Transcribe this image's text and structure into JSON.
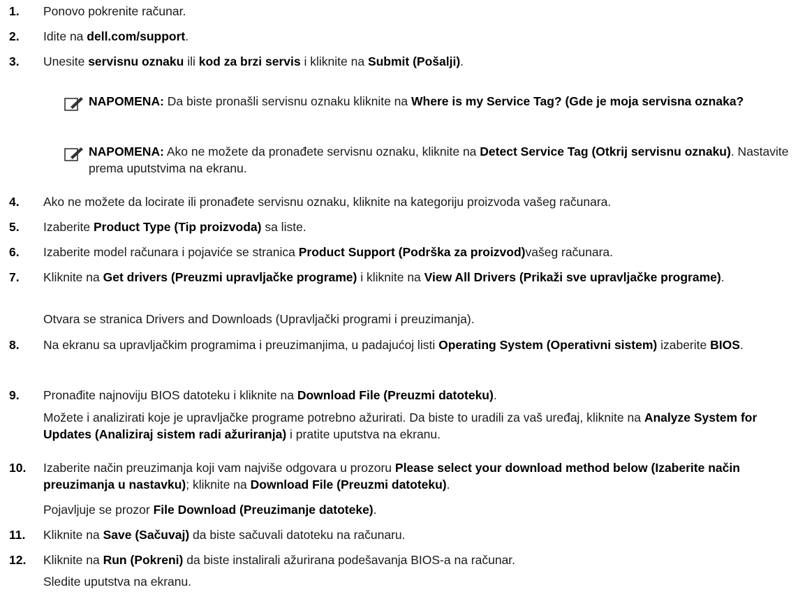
{
  "steps": [
    {
      "n": "1.",
      "parts": [
        {
          "t": "Ponovo pokrenite računar."
        }
      ]
    },
    {
      "n": "2.",
      "parts": [
        {
          "t": "Idite na "
        },
        {
          "t": "dell.com/support",
          "b": true
        },
        {
          "t": "."
        }
      ]
    },
    {
      "n": "3.",
      "parts": [
        {
          "t": "Unesite "
        },
        {
          "t": "servisnu oznaku",
          "b": true
        },
        {
          "t": " ili "
        },
        {
          "t": "kod za brzi servis",
          "b": true
        },
        {
          "t": " i kliknite na "
        },
        {
          "t": "Submit (Pošalji)",
          "b": true
        },
        {
          "t": "."
        }
      ]
    },
    {
      "n": "4.",
      "parts": [
        {
          "t": "Ako ne možete da locirate ili pronađete servisnu oznaku, kliknite na kategoriju proizvoda vašeg računara."
        }
      ]
    },
    {
      "n": "5.",
      "parts": [
        {
          "t": "Izaberite "
        },
        {
          "t": "Product Type (Tip proizvoda)",
          "b": true
        },
        {
          "t": " sa liste."
        }
      ]
    },
    {
      "n": "6.",
      "parts": [
        {
          "t": "Izaberite model računara i pojaviće se stranica "
        },
        {
          "t": "Product Support (Podrška za proizvod)",
          "b": true
        },
        {
          "t": "vašeg računara."
        }
      ]
    },
    {
      "n": "7.",
      "parts": [
        {
          "t": "Kliknite na "
        },
        {
          "t": "Get drivers (Preuzmi upravljačke programe)",
          "b": true
        },
        {
          "t": " i kliknite na "
        },
        {
          "t": "View All Drivers (Prikaži sve upravljačke programe)",
          "b": true
        },
        {
          "t": "."
        }
      ],
      "extra": [
        {
          "t": "Otvara se stranica Drivers and Downloads (Upravljački programi i preuzimanja)."
        }
      ]
    },
    {
      "n": "8.",
      "parts": [
        {
          "t": "Na ekranu sa upravljačkim programima i preuzimanjima, u padajućoj listi "
        },
        {
          "t": "Operating System (Operativni sistem)",
          "b": true
        },
        {
          "t": " izaberite "
        },
        {
          "t": "BIOS",
          "b": true
        },
        {
          "t": "."
        }
      ]
    },
    {
      "n": "9.",
      "parts": [
        {
          "t": "Pronađite najnoviju BIOS datoteku i kliknite na "
        },
        {
          "t": "Download File (Preuzmi datoteku)",
          "b": true
        },
        {
          "t": "."
        }
      ],
      "extra": [
        {
          "t": "Možete i analizirati koje je upravljačke programe potrebno ažurirati. Da biste to uradili za vaš uređaj, kliknite na "
        },
        {
          "t": "Analyze System for Updates (Analiziraj sistem radi ažuriranja)",
          "b": true
        },
        {
          "t": " i pratite uputstva na ekranu."
        }
      ]
    },
    {
      "n": "10.",
      "parts": [
        {
          "t": "Izaberite način preuzimanja koji vam najviše odgovara u prozoru "
        },
        {
          "t": "Please select your download method below (Izaberite način preuzimanja u nastavku)",
          "b": true
        },
        {
          "t": "; kliknite na "
        },
        {
          "t": "Download File (Preuzmi datoteku)",
          "b": true
        },
        {
          "t": "."
        }
      ],
      "extra": [
        {
          "t": "Pojavljuje se prozor "
        },
        {
          "t": "File Download (Preuzimanje datoteke)",
          "b": true
        },
        {
          "t": "."
        }
      ]
    },
    {
      "n": "11.",
      "parts": [
        {
          "t": "Kliknite na "
        },
        {
          "t": "Save (Sačuvaj)",
          "b": true
        },
        {
          "t": " da biste sačuvali datoteku na računaru."
        }
      ]
    },
    {
      "n": "12.",
      "parts": [
        {
          "t": "Kliknite na "
        },
        {
          "t": "Run (Pokreni)",
          "b": true
        },
        {
          "t": " da biste instalirali ažurirana podešavanja BIOS-a na računar."
        }
      ],
      "extra": [
        {
          "t": "Sledite uputstva na ekranu."
        }
      ]
    }
  ],
  "notes": [
    {
      "parts": [
        {
          "t": "NAPOMENA:",
          "b": true
        },
        {
          "t": " Da biste pronašli servisnu oznaku kliknite na "
        },
        {
          "t": "Where is my Service Tag? (Gde je moja servisna oznaka?",
          "b": true
        }
      ]
    },
    {
      "parts": [
        {
          "t": "NAPOMENA:",
          "b": true
        },
        {
          "t": " Ako ne možete da pronađete servisnu oznaku, kliknite na "
        },
        {
          "t": "Detect Service Tag (Otkrij servisnu oznaku)",
          "b": true
        },
        {
          "t": ". Nastavite prema uputstvima na ekranu."
        }
      ]
    }
  ],
  "icons": {
    "note": "pencil-note-icon"
  }
}
